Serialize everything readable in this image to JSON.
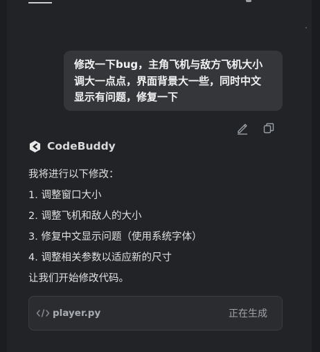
{
  "user_message": {
    "lines": [
      "修改一下bug，主角飞机与敌方飞机大小",
      "调大一点点，界面背景大一些，同时中文",
      "显示有问题，修复一下"
    ]
  },
  "message_actions": {
    "edit_icon": "pencil-icon",
    "copy_icon": "copy-icon"
  },
  "assistant": {
    "name": "CodeBuddy",
    "logo_icon": "codebuddy-logo-icon"
  },
  "reply": {
    "lines": [
      "我将进行以下修改：",
      "1. 调整窗口大小",
      "2. 调整飞机和敌人的大小",
      "3. 修复中文显示问题（使用系统字体）",
      "4. 调整相关参数以适应新的尺寸",
      "让我们开始修改代码。"
    ]
  },
  "file_card": {
    "icon": "code-icon",
    "file_name": "player.py",
    "status": "正在生成"
  },
  "colors": {
    "background": "#1c1d20",
    "panel": "#212327",
    "bubble": "#34363a",
    "card": "#2a2c30"
  }
}
